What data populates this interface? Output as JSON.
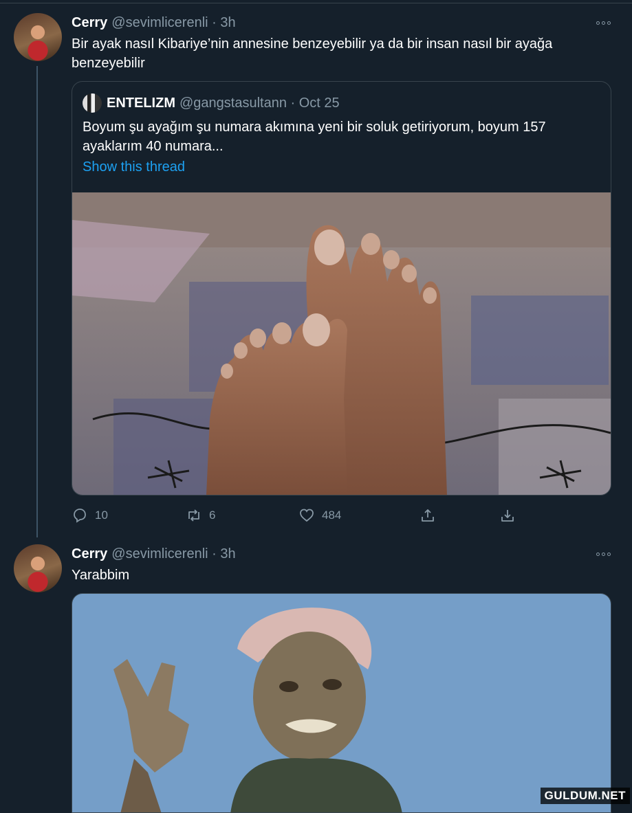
{
  "tweet1": {
    "name": "Cerry",
    "handle": "@sevimlicerenli · 3h",
    "text": "Bir ayak nasıl Kibariye’nin annesine benzeyebilir ya da bir insan nasıl bir ayağa benzeyebilir",
    "quoted": {
      "name": "ENTELIZM",
      "handle": "@gangstasultann · Oct 25",
      "text": "Boyum şu ayağım şu numara akımına yeni bir soluk getiriyorum, boyum 157 ayaklarım 40 numara...",
      "link": "Show this thread"
    },
    "actions": {
      "replies": "10",
      "retweets": "6",
      "likes": "484"
    }
  },
  "tweet2": {
    "name": "Cerry",
    "handle": "@sevimlicerenli · 3h",
    "text": "Yarabbim"
  },
  "watermark": "GULDUM.NET",
  "colors": {
    "background": "#15202b",
    "border": "#38444d",
    "secondary_text": "#8899a6",
    "link": "#1da1f2"
  },
  "icons": [
    "more-icon",
    "reply-icon",
    "retweet-icon",
    "like-icon",
    "share-icon",
    "download-icon"
  ]
}
